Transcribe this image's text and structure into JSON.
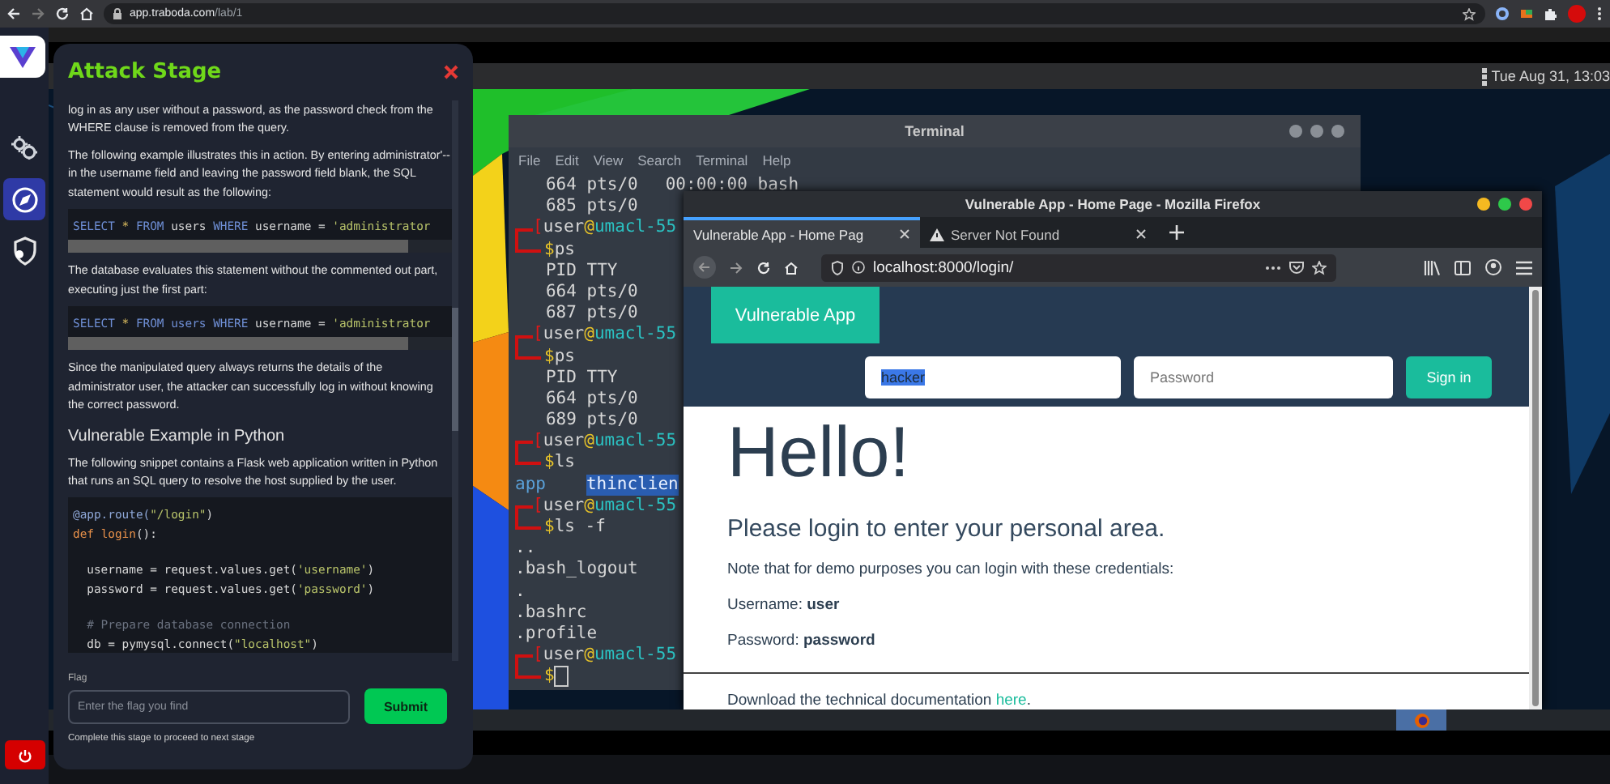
{
  "browser": {
    "url_host": "app.traboda.com",
    "url_path": "/lab/1"
  },
  "sidebar": {
    "items": [
      {
        "kind": "gear",
        "selected": false
      },
      {
        "kind": "compass",
        "selected": true
      },
      {
        "kind": "shield",
        "selected": false
      }
    ]
  },
  "desktop": {
    "clock": "Tue Aug 31, 13:03"
  },
  "attack_panel": {
    "title": "Attack Stage",
    "content": [
      {
        "kind": "p",
        "text": "log in as any user without a password, as the password check from the WHERE clause is removed from the query."
      },
      {
        "kind": "p",
        "text": "The following example illustrates this in action. By entering administrator'-- in the username field and leaving the password field blank, the SQL statement would result as the following:"
      },
      {
        "kind": "code",
        "scroll": true,
        "lines": [
          {
            "tokens": [
              {
                "text": "SELECT",
                "kind": "keyword"
              },
              {
                "text": " * ",
                "kind": "operator"
              },
              {
                "text": "FROM",
                "kind": "keyword"
              },
              {
                "text": " users ",
                "kind": "plain"
              },
              {
                "text": "WHERE",
                "kind": "keyword"
              },
              {
                "text": " username = ",
                "kind": "plain"
              },
              {
                "text": "'administrator",
                "kind": "string"
              }
            ]
          }
        ]
      },
      {
        "kind": "p",
        "text": "The database evaluates this statement without the commented out part, executing just the first part:"
      },
      {
        "kind": "code",
        "scroll": true,
        "lines": [
          {
            "tokens": [
              {
                "text": "SELECT",
                "kind": "keyword"
              },
              {
                "text": " * ",
                "kind": "operator"
              },
              {
                "text": "FROM",
                "kind": "keyword"
              },
              {
                "text": " users ",
                "kind": "keyword"
              },
              {
                "text": "WHERE",
                "kind": "keyword"
              },
              {
                "text": " username = ",
                "kind": "plain"
              },
              {
                "text": "'administrator",
                "kind": "string"
              }
            ]
          }
        ]
      },
      {
        "kind": "p",
        "text": "Since the manipulated query always returns the details of the administrator user, the attacker can successfully log in without knowing the correct password."
      },
      {
        "kind": "h",
        "text": "Vulnerable Example in Python"
      },
      {
        "kind": "p",
        "text": "The following snippet contains a Flask web application written in Python that runs an SQL query to resolve the host supplied by the user."
      },
      {
        "kind": "code",
        "scroll": false,
        "lines": [
          {
            "spaced": false,
            "tokens": [
              {
                "text": "@app.route(",
                "kind": "decorator"
              },
              {
                "text": "\"/login\"",
                "kind": "string"
              },
              {
                "text": ")",
                "kind": "plain"
              }
            ]
          },
          {
            "spaced": false,
            "tokens": [
              {
                "text": "def ",
                "kind": "function"
              },
              {
                "text": "login",
                "kind": "function"
              },
              {
                "text": "():",
                "kind": "plain"
              }
            ]
          },
          {
            "spaced": true,
            "tokens": [
              {
                "text": "  username = request.values.get(",
                "kind": "plain"
              },
              {
                "text": "'username'",
                "kind": "string"
              },
              {
                "text": ")",
                "kind": "plain"
              }
            ]
          },
          {
            "spaced": false,
            "tokens": [
              {
                "text": "  password = request.values.get(",
                "kind": "plain"
              },
              {
                "text": "'password'",
                "kind": "string"
              },
              {
                "text": ")",
                "kind": "plain"
              }
            ]
          },
          {
            "spaced": true,
            "tokens": [
              {
                "text": "  # Prepare database connection",
                "kind": "comment"
              }
            ]
          },
          {
            "spaced": false,
            "tokens": [
              {
                "text": "  db = pymysql.connect(",
                "kind": "plain"
              },
              {
                "text": "\"localhost\"",
                "kind": "string"
              },
              {
                "text": ")",
                "kind": "plain"
              }
            ]
          }
        ]
      }
    ],
    "flag": {
      "label": "Flag",
      "placeholder": "Enter the flag you find"
    },
    "submit": "Submit",
    "note": "Complete this stage to proceed to next stage"
  },
  "terminal": {
    "title": "Terminal",
    "menu": [
      "File",
      "Edit",
      "View",
      "Search",
      "Terminal",
      "Help"
    ],
    "lines": [
      {
        "kind": "out",
        "text": "   664 pts/0",
        "extra": "00:00:00 bash"
      },
      {
        "kind": "out",
        "text": "   685 pts/0"
      },
      {
        "kind": "prompt",
        "open": "[",
        "user": "user",
        "at": "@",
        "host": "umacl-55"
      },
      {
        "kind": "cmd",
        "sign": "$",
        "text": "ps",
        "cursor": false
      },
      {
        "kind": "out",
        "text": "   PID TTY"
      },
      {
        "kind": "out",
        "text": "   664 pts/0"
      },
      {
        "kind": "out",
        "text": "   687 pts/0"
      },
      {
        "kind": "prompt",
        "open": "[",
        "user": "user",
        "at": "@",
        "host": "umacl-55"
      },
      {
        "kind": "cmd",
        "sign": "$",
        "text": "ps",
        "cursor": false
      },
      {
        "kind": "out",
        "text": "   PID TTY"
      },
      {
        "kind": "out",
        "text": "   664 pts/0"
      },
      {
        "kind": "out",
        "text": "   689 pts/0"
      },
      {
        "kind": "prompt",
        "open": "[",
        "user": "user",
        "at": "@",
        "host": "umacl-55"
      },
      {
        "kind": "cmd",
        "sign": "$",
        "text": "ls",
        "cursor": false
      },
      {
        "kind": "ls",
        "items": [
          {
            "text": "app",
            "selected": false
          },
          {
            "text": "thinclien",
            "selected": true
          }
        ]
      },
      {
        "kind": "prompt",
        "open": "[",
        "user": "user",
        "at": "@",
        "host": "umacl-55"
      },
      {
        "kind": "cmd",
        "sign": "$",
        "text": "ls -f",
        "cursor": false
      },
      {
        "kind": "out",
        "text": ".."
      },
      {
        "kind": "out",
        "text": ".bash_logout"
      },
      {
        "kind": "out",
        "text": "."
      },
      {
        "kind": "out",
        "text": ".bashrc"
      },
      {
        "kind": "out",
        "text": ".profile"
      },
      {
        "kind": "prompt",
        "open": "[",
        "user": "user",
        "at": "@",
        "host": "umacl-55"
      },
      {
        "kind": "cmd",
        "sign": "$",
        "cursor": true
      }
    ]
  },
  "firefox": {
    "title": "Vulnerable App - Home Page - Mozilla Firefox",
    "tabs": [
      {
        "label": "Vulnerable App - Home Pag",
        "selected": true,
        "warning": false
      },
      {
        "label": "Server Not Found",
        "selected": false,
        "warning": true
      }
    ],
    "url": "localhost:8000/login/",
    "page": {
      "brand": "Vulnerable App",
      "username": "hacker",
      "username_selected": true,
      "password_placeholder": "Password",
      "signin": "Sign in",
      "heading": "Hello!",
      "lead": "Please login to enter your personal area.",
      "note": "Note that for demo purposes you can login with these credentials:",
      "credentials": [
        "Username: **user**",
        "Password: **password**"
      ],
      "footer_text": "Download the technical documentation ",
      "footer_link": "here",
      "footer_end": "."
    }
  }
}
